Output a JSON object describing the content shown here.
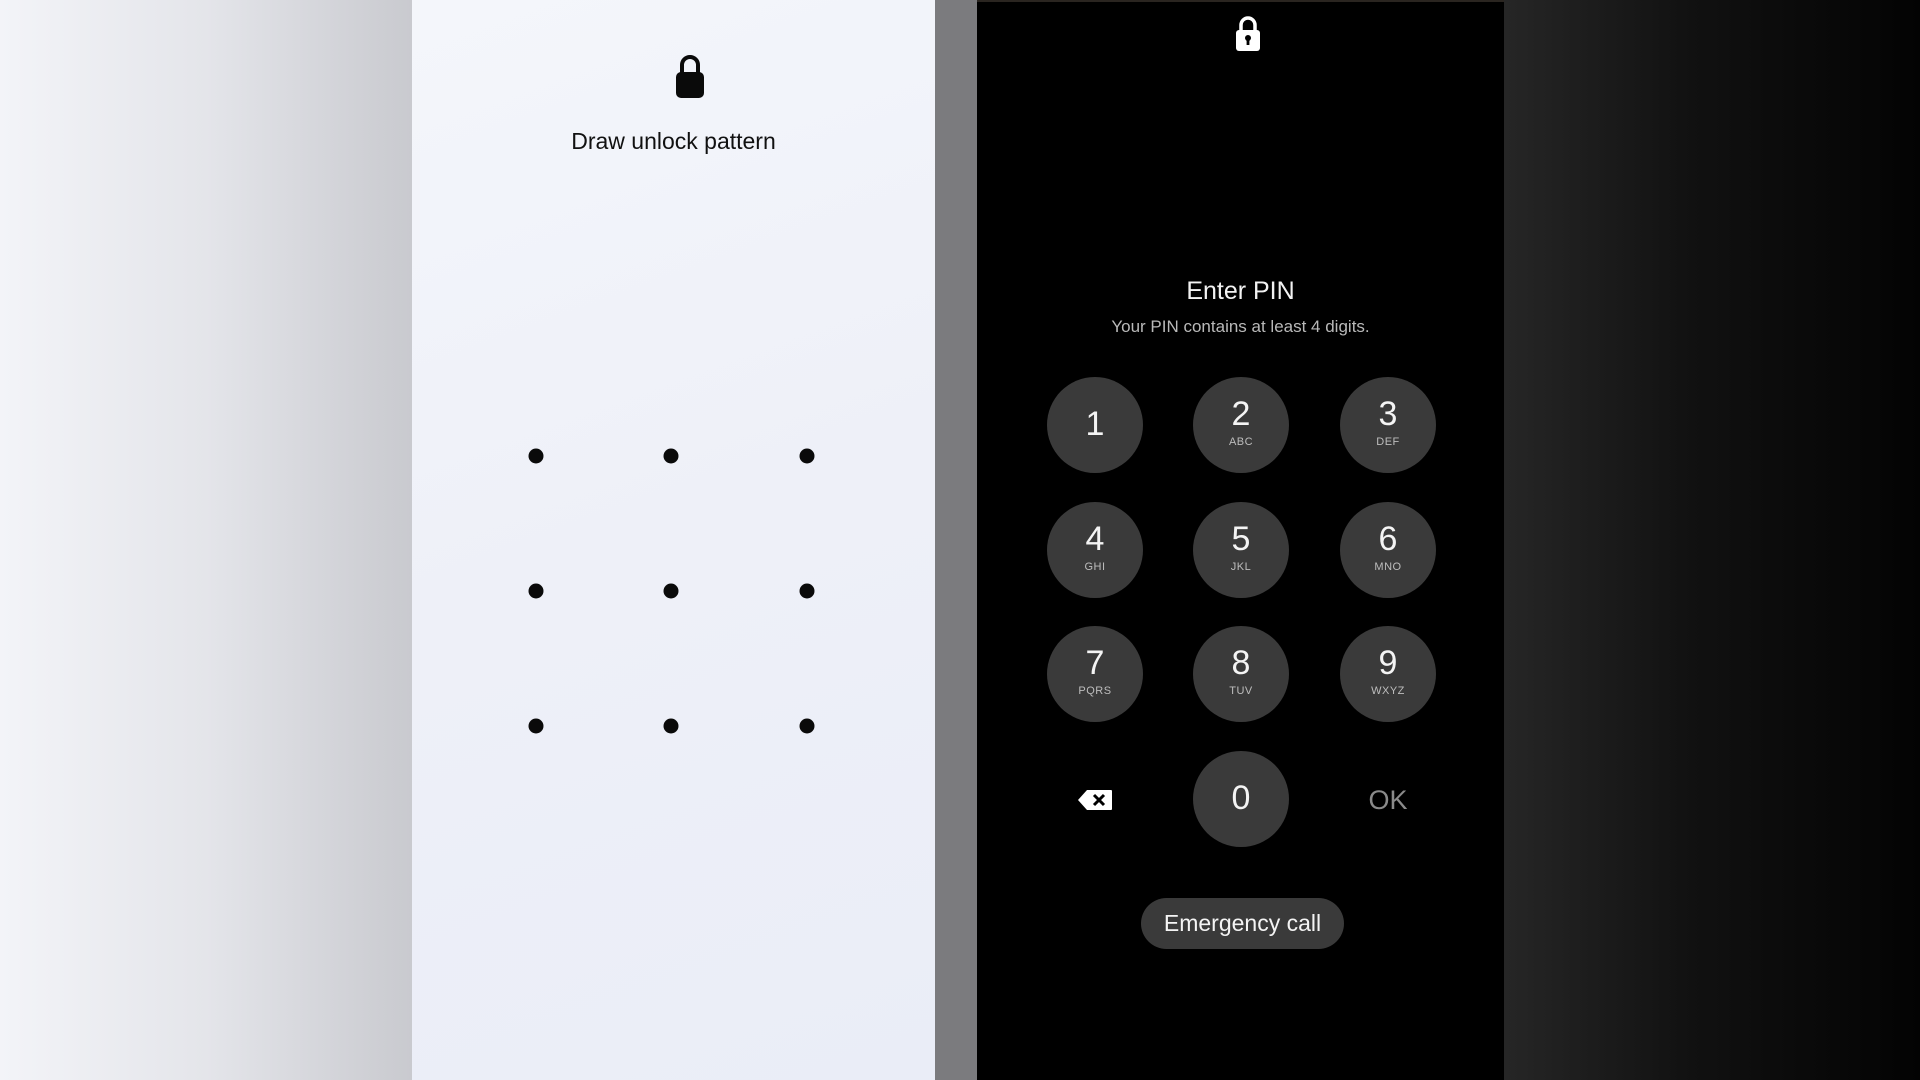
{
  "pattern_screen": {
    "title": "Draw unlock pattern",
    "lock_icon": "lock-icon",
    "grid": {
      "rows": 3,
      "cols": 3
    }
  },
  "pin_screen": {
    "lock_icon": "lock-icon",
    "title": "Enter PIN",
    "subtitle": "Your PIN contains at least 4 digits.",
    "keys": [
      {
        "digit": "1",
        "letters": ""
      },
      {
        "digit": "2",
        "letters": "ABC"
      },
      {
        "digit": "3",
        "letters": "DEF"
      },
      {
        "digit": "4",
        "letters": "GHI"
      },
      {
        "digit": "5",
        "letters": "JKL"
      },
      {
        "digit": "6",
        "letters": "MNO"
      },
      {
        "digit": "7",
        "letters": "PQRS"
      },
      {
        "digit": "8",
        "letters": "TUV"
      },
      {
        "digit": "9",
        "letters": "WXYZ"
      },
      {
        "digit": "0",
        "letters": ""
      }
    ],
    "backspace_icon": "backspace-icon",
    "ok_label": "OK",
    "emergency_label": "Emergency call"
  },
  "colors": {
    "key_bg": "#3a3a3a",
    "dark_bg": "#000000",
    "light_bg": "#eef0f8",
    "ok_text": "#8a8a8a"
  }
}
